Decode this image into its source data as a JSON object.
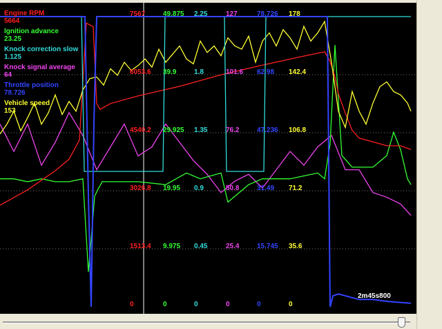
{
  "legend": [
    {
      "name": "Engine RPM",
      "value": "5664",
      "color": "#ff2020"
    },
    {
      "name": "Ignition advance",
      "value": "23.25",
      "color": "#33ff33"
    },
    {
      "name": "Knock correction slow",
      "value": "1.125",
      "color": "#33dddd"
    },
    {
      "name": "Knock signal average",
      "value": "64",
      "color": "#ee44ee"
    },
    {
      "name": "Throttle position",
      "value": "78.726",
      "color": "#3344ff"
    },
    {
      "name": "Vehicle speed",
      "value": "153",
      "color": "#ffff33"
    }
  ],
  "scale_rows": [
    [
      "7567",
      "49.875",
      "2.25",
      "127",
      "78.726",
      "178"
    ],
    [
      "6053.6",
      "39.9",
      "1.8",
      "101.6",
      "62.98",
      "142.4"
    ],
    [
      "4540.2",
      "29.925",
      "1.35",
      "76.2",
      "47.236",
      "106.8"
    ],
    [
      "3026.8",
      "19.95",
      "0.9",
      "50.8",
      "31.49",
      "71.2"
    ],
    [
      "1513.4",
      "9.975",
      "0.45",
      "25.4",
      "15.745",
      "35.6"
    ],
    [
      "0",
      "0",
      "0",
      "0",
      "0",
      "0"
    ]
  ],
  "scale_colors": [
    "#ff2020",
    "#33ff33",
    "#33dddd",
    "#ee44ee",
    "#3344ff",
    "#ffff33"
  ],
  "time_label": "2m45s800",
  "chart_data": {
    "type": "line",
    "series": [
      {
        "name": "Engine RPM",
        "x": [
          0,
          20,
          40,
          60,
          80,
          100,
          115,
          125,
          135,
          140,
          145,
          160,
          200,
          260,
          320,
          380,
          430,
          470,
          478,
          485,
          490,
          500,
          510,
          520,
          540,
          560,
          580,
          595
        ],
        "values": [
          2650,
          2850,
          3050,
          3300,
          3550,
          3850,
          4350,
          7400,
          7300,
          5300,
          5150,
          5300,
          5500,
          5750,
          6050,
          6300,
          6500,
          6650,
          6400,
          6000,
          5550,
          5050,
          4600,
          4400,
          4300,
          4200,
          4200,
          4100
        ]
      },
      {
        "name": "Ignition advance",
        "x": [
          0,
          20,
          40,
          60,
          80,
          100,
          120,
          128,
          133,
          137,
          141,
          148,
          160,
          200,
          240,
          270,
          290,
          320,
          330,
          360,
          380,
          420,
          460,
          470,
          478,
          485,
          495,
          510,
          540,
          560,
          570,
          580,
          590,
          595
        ],
        "values": [
          22,
          22,
          21.5,
          22,
          21.5,
          21.5,
          22,
          6,
          13,
          19,
          20,
          21.5,
          21.5,
          21.5,
          21,
          23,
          22,
          23,
          18,
          21,
          22,
          22,
          23,
          22,
          28,
          45,
          26,
          24,
          24,
          26,
          30,
          27,
          22,
          21
        ]
      },
      {
        "name": "Knock correction slow",
        "x": [
          0,
          118,
          122,
          128,
          134,
          140,
          236,
          239,
          325,
          328,
          382,
          385,
          476,
          479,
          595
        ],
        "values": [
          2.25,
          2.25,
          1.05,
          1.05,
          1.05,
          1.05,
          1.05,
          2.25,
          2.25,
          1.05,
          1.05,
          2.25,
          2.25,
          2.25,
          2.25
        ]
      },
      {
        "name": "Knock signal average",
        "x": [
          0,
          20,
          40,
          60,
          80,
          100,
          120,
          140,
          160,
          180,
          200,
          220,
          240,
          260,
          280,
          300,
          320,
          340,
          360,
          380,
          400,
          420,
          440,
          460,
          480,
          500,
          520,
          540,
          560,
          580,
          595
        ],
        "values": [
          80,
          68,
          80,
          62,
          72,
          85,
          75,
          60,
          70,
          80,
          66,
          70,
          80,
          72,
          64,
          58,
          50,
          55,
          58,
          52,
          60,
          68,
          62,
          70,
          75,
          60,
          60,
          50,
          48,
          45,
          40
        ]
      },
      {
        "name": "Throttle position",
        "x": [
          0,
          118,
          123,
          128,
          132,
          136,
          140,
          145,
          152,
          160,
          470,
          474,
          478,
          482,
          490,
          520,
          540,
          560,
          595
        ],
        "values": [
          78.726,
          78.726,
          78.726,
          30,
          0,
          50,
          78.726,
          78.726,
          78.726,
          78.726,
          78.726,
          78.726,
          0,
          3,
          3.5,
          2,
          2,
          1.5,
          1
        ]
      },
      {
        "name": "Vehicle speed",
        "x": [
          0,
          10,
          20,
          30,
          40,
          50,
          60,
          70,
          80,
          90,
          100,
          110,
          120,
          130,
          140,
          150,
          160,
          170,
          180,
          190,
          200,
          210,
          220,
          230,
          240,
          250,
          260,
          270,
          280,
          290,
          300,
          310,
          320,
          330,
          340,
          350,
          360,
          370,
          380,
          390,
          400,
          410,
          420,
          430,
          440,
          450,
          460,
          470,
          480,
          490,
          500,
          510,
          520,
          530,
          540,
          550,
          560,
          570,
          580,
          590,
          595
        ],
        "values": [
          106,
          112,
          120,
          108,
          116,
          125,
          112,
          119,
          130,
          118,
          126,
          120,
          133,
          140,
          141,
          136,
          146,
          142,
          150,
          145,
          148,
          152,
          147,
          158,
          150,
          155,
          160,
          152,
          149,
          163,
          156,
          160,
          154,
          165,
          160,
          158,
          166,
          150,
          163,
          168,
          160,
          170,
          165,
          158,
          172,
          163,
          168,
          175,
          150,
          120,
          110,
          132,
          120,
          112,
          125,
          135,
          138,
          132,
          130,
          125,
          120
        ]
      }
    ],
    "time_label": "2m45s800"
  }
}
